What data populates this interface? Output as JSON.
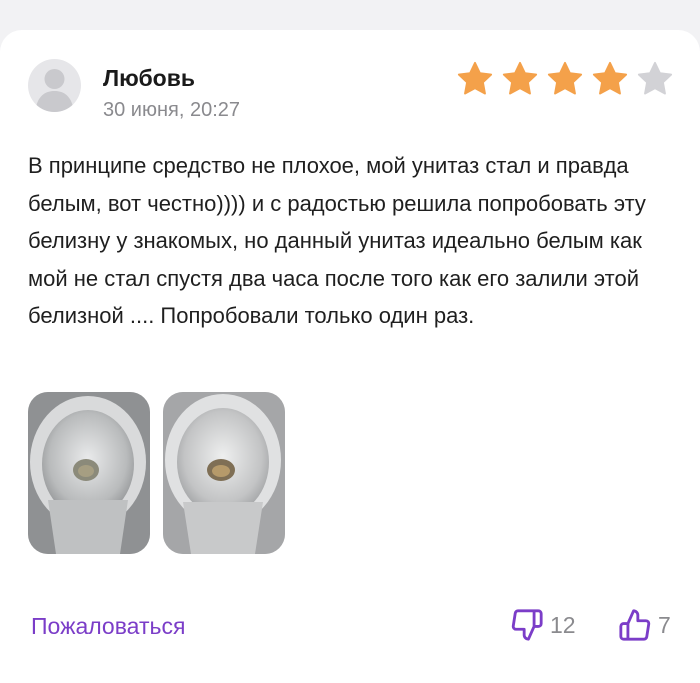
{
  "review": {
    "author": "Любовь",
    "date": "30 июня, 20:27",
    "rating": 4,
    "rating_max": 5,
    "text": "В принципе средство не плохое, мой унитаз стал и правда белым, вот честно)))) и с радостью решила попробовать эту белизну у знакомых, но данный унитаз идеально белым как мой не стал спустя два часа после того как его залили этой белизной .... Попробовали только один раз.",
    "photos": [
      "toilet-photo-1",
      "toilet-photo-2"
    ]
  },
  "actions": {
    "report_label": "Пожаловаться",
    "dislike_count": "12",
    "like_count": "7"
  },
  "colors": {
    "star_filled": "#f4a14a",
    "star_empty": "#d2d2d6",
    "accent": "#7b3dc8",
    "muted": "#8a8a8e"
  }
}
